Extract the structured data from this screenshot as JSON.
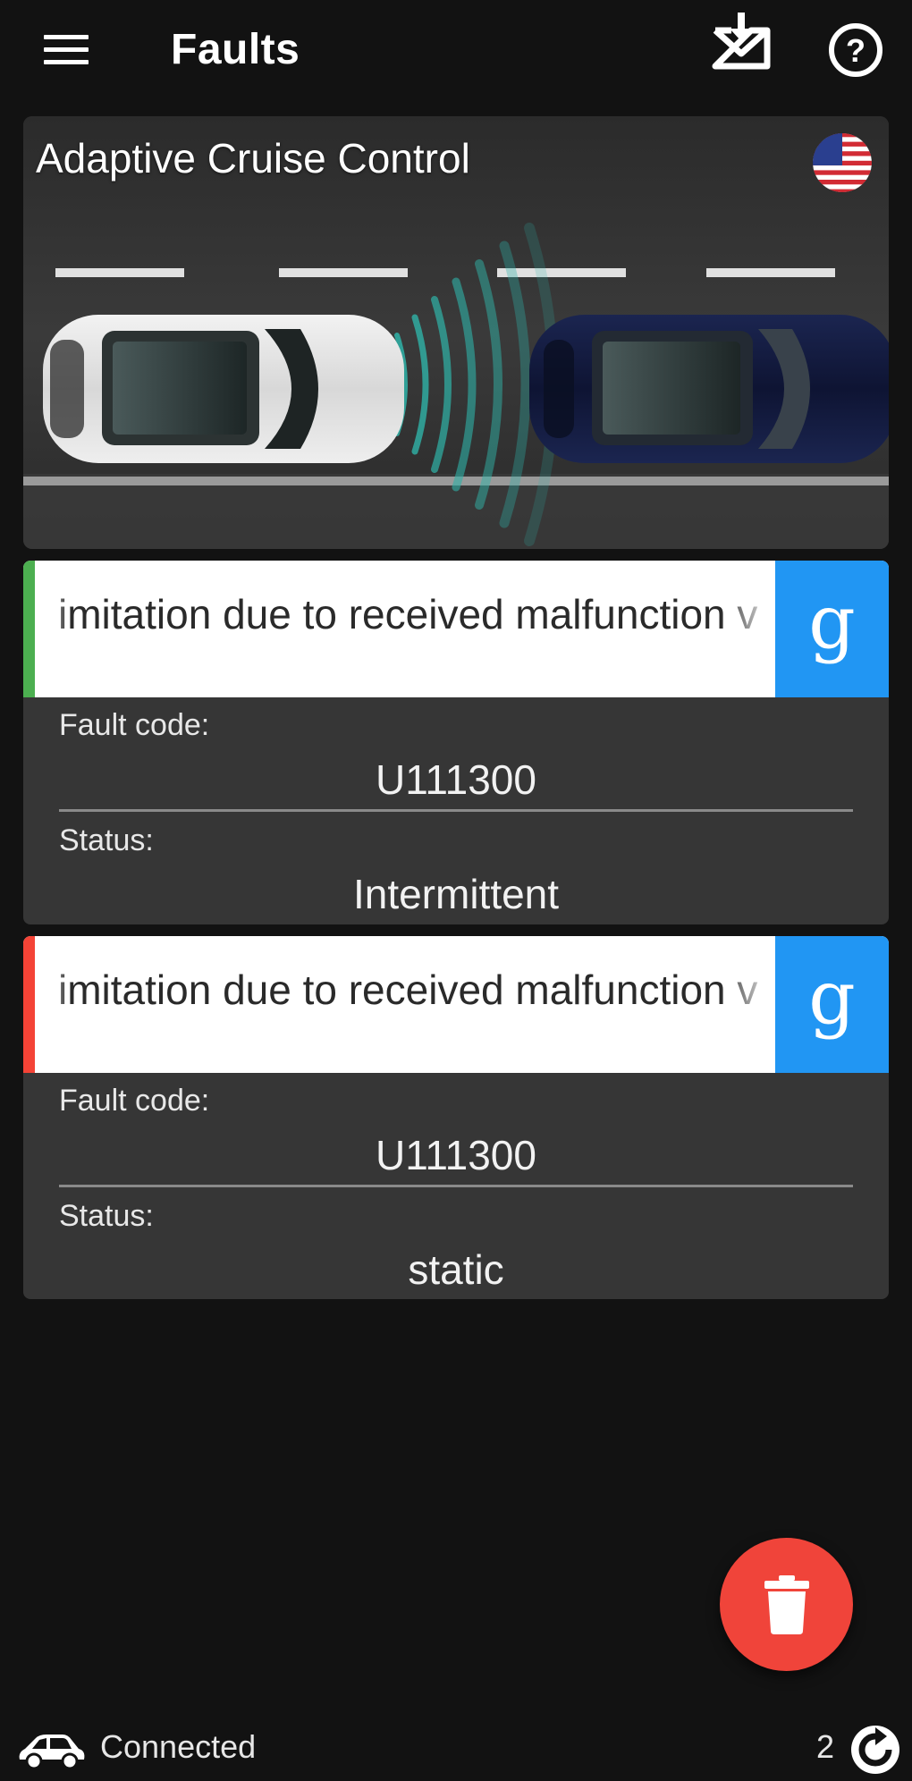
{
  "header": {
    "title": "Faults",
    "menu_icon": "hamburger-menu-icon",
    "save_icon": "inbox-download-icon",
    "help_icon": "help-circle-icon"
  },
  "system": {
    "name": "Adaptive Cruise Control",
    "language_icon": "us-flag-icon"
  },
  "faults": [
    {
      "description": "imitation due to received malfunction v",
      "fault_code_label": "Fault code:",
      "fault_code": "U111300",
      "status_label": "Status:",
      "status": "Intermittent",
      "accent_color": "#4caf50",
      "search_icon": "google-g-icon"
    },
    {
      "description": "imitation due to received malfunction v",
      "fault_code_label": "Fault code:",
      "fault_code": "U111300",
      "status_label": "Status:",
      "status": "static",
      "accent_color": "#f44336",
      "search_icon": "google-g-icon"
    }
  ],
  "fab": {
    "icon": "trash-icon",
    "color": "#f0443a"
  },
  "status_bar": {
    "connection": "Connected",
    "count": "2",
    "car_icon": "car-icon",
    "refresh_icon": "refresh-icon"
  },
  "colors": {
    "background": "#121212",
    "card": "#363636",
    "google_button": "#2196f3"
  }
}
